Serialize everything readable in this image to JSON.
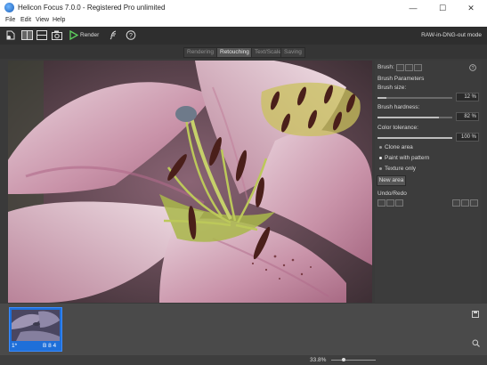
{
  "window": {
    "title": "Helicon Focus 7.0.0 - Registered Pro unlimited",
    "minimize": "—",
    "maximize": "☐",
    "close": "✕"
  },
  "menu": {
    "items": [
      "File",
      "Edit",
      "View",
      "Help"
    ]
  },
  "toolbar": {
    "render_label": "Render",
    "mode_label": "RAW-in-DNG-out mode",
    "icons": [
      "open-file-icon",
      "split-vertical-icon",
      "split-horizontal-icon",
      "camera-icon",
      "render-play-icon",
      "feather-icon",
      "help-icon"
    ]
  },
  "tabs": [
    "Rendering",
    "Retouching",
    "Text/Scale",
    "Saving"
  ],
  "active_tab": "Retouching",
  "panel": {
    "brush_label": "Brush:",
    "brush_params_title": "Brush Parameters",
    "brush_size_label": "Brush size:",
    "brush_size_value": "12 %",
    "brush_size_fraction": 0.12,
    "brush_hardness_label": "Brush hardness:",
    "brush_hardness_value": "82 %",
    "brush_hardness_fraction": 0.82,
    "color_tolerance_label": "Color tolerance:",
    "color_tolerance_value": "100 %",
    "color_tolerance_fraction": 1.0,
    "options": [
      "Clone area",
      "Paint with pattern",
      "Texture only"
    ],
    "new_area_label": "New area",
    "undo_redo_title": "Undo/Redo"
  },
  "thumbnail": {
    "index": "1*",
    "label": "B 8 4"
  },
  "status": {
    "zoom": "33.8%"
  },
  "colors": {
    "accent": "#1e6fd9",
    "toolbar_bg": "#2e2e2e",
    "panel_bg": "#3c3c3c"
  }
}
